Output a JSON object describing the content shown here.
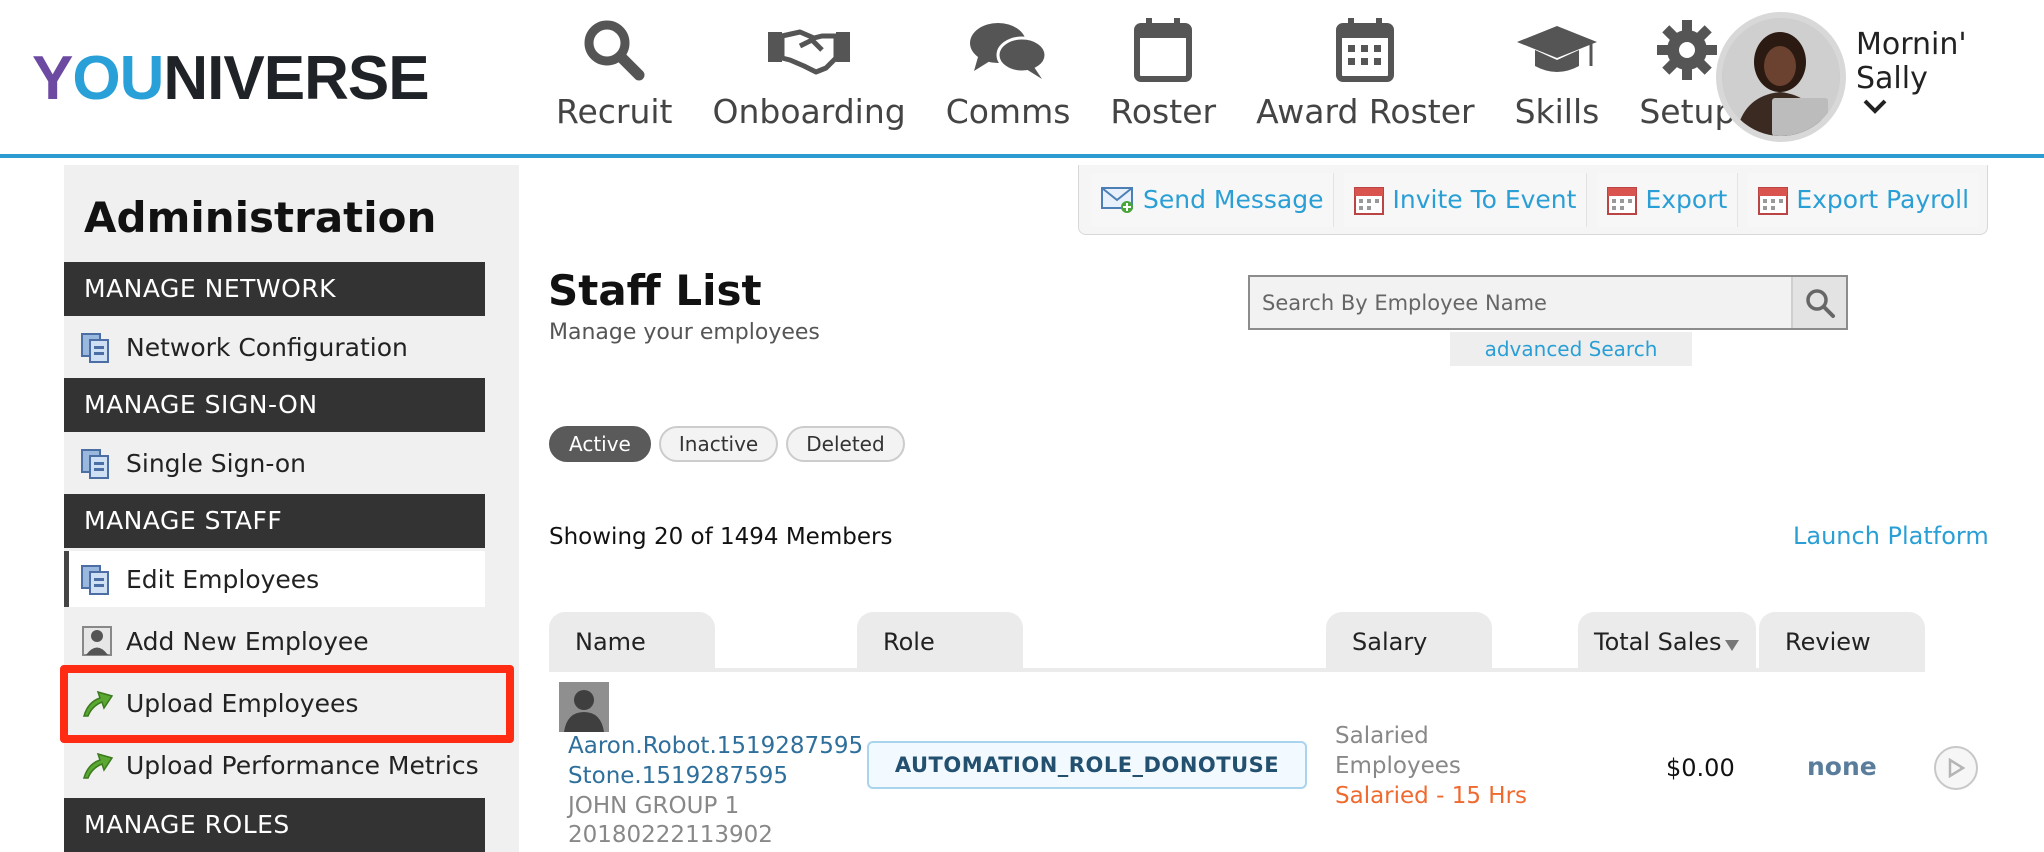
{
  "brand": {
    "logo_text_y": "Y",
    "logo_text_o": "O",
    "logo_text_u": "U",
    "logo_text_rest": "NIVERSE"
  },
  "nav": [
    {
      "label": "Recruit",
      "icon": "search-icon"
    },
    {
      "label": "Onboarding",
      "icon": "handshake-icon"
    },
    {
      "label": "Comms",
      "icon": "chat-bubbles-icon"
    },
    {
      "label": "Roster",
      "icon": "calendar-icon"
    },
    {
      "label": "Award Roster",
      "icon": "calendar-grid-icon"
    },
    {
      "label": "Skills",
      "icon": "graduation-cap-icon"
    },
    {
      "label": "Setup",
      "icon": "gear-icon"
    }
  ],
  "user": {
    "greeting": "Mornin'",
    "name": "Sally"
  },
  "sidebar": {
    "title": "Administration",
    "sections": [
      {
        "label": "MANAGE NETWORK"
      },
      {
        "label": "MANAGE SIGN-ON"
      },
      {
        "label": "MANAGE STAFF"
      },
      {
        "label": "MANAGE ROLES"
      }
    ],
    "items": [
      {
        "label": "Network Configuration"
      },
      {
        "label": "Single Sign-on"
      },
      {
        "label": "Edit Employees"
      },
      {
        "label": "Add New Employee"
      },
      {
        "label": "Upload Employees"
      },
      {
        "label": "Upload Performance Metrics"
      }
    ]
  },
  "actions": [
    {
      "label": "Send Message",
      "icon": "envelope-icon"
    },
    {
      "label": "Invite To Event",
      "icon": "calendar-icon"
    },
    {
      "label": "Export",
      "icon": "calendar-icon"
    },
    {
      "label": "Export Payroll",
      "icon": "calendar-icon"
    }
  ],
  "main": {
    "title": "Staff List",
    "subtitle": "Manage your employees",
    "search_placeholder": "Search By Employee Name",
    "advanced_search": "advanced Search",
    "filters": [
      "Active",
      "Inactive",
      "Deleted"
    ],
    "active_filter": "Active",
    "showing": "Showing 20 of 1494 Members",
    "launch_platform": "Launch Platform",
    "columns": [
      "Name",
      "Role",
      "Salary",
      "Total Sales",
      "Review"
    ],
    "sort_column": "Total Sales",
    "rows": [
      {
        "name_line1": "Aaron.Robot.1519287595",
        "name_line2": "Stone.1519287595",
        "group": "JOHN GROUP 1",
        "id": "20180222113902",
        "role": "AUTOMATION_ROLE_DONOTUSE",
        "salary_line1": "Salaried",
        "salary_line2": "Employees",
        "salary_type": "Salaried - 15 Hrs",
        "total_sales": "$0.00",
        "review": "none"
      }
    ]
  },
  "colors": {
    "accent": "#2a9fd6",
    "header_rule": "#2b9bd1",
    "section_bg": "#333333",
    "highlight": "#ff2b12",
    "salary_type": "#ef6a2e"
  }
}
